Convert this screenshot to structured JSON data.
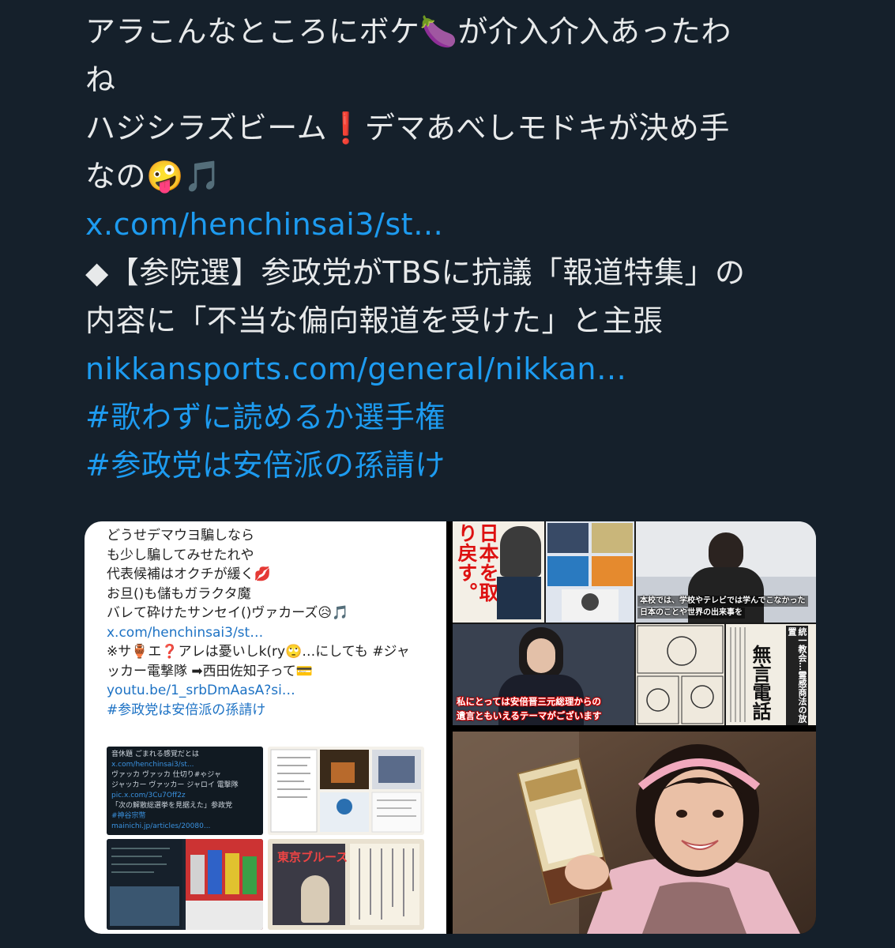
{
  "tweet": {
    "lines": [
      {
        "text": "アラこんなところにボケ🍆が介入介入あったわ",
        "link": false
      },
      {
        "text": "ね",
        "link": false
      },
      {
        "text": "ハジシラズビーム❗デマあべしモドキが決め手",
        "link": false
      },
      {
        "text": "なの🤪🎵",
        "link": false
      },
      {
        "text": "x.com/henchinsai3/st…",
        "link": true
      },
      {
        "text": "◆【参院選】参政党がTBSに抗議「報道特集」の",
        "link": false
      },
      {
        "text": "内容に「不当な偏向報道を受けた」と主張",
        "link": false
      },
      {
        "text": "nikkansports.com/general/nikkan…",
        "link": true
      },
      {
        "text": "#歌わずに読めるか選手権",
        "link": true
      },
      {
        "text": "#参政党は安倍派の孫請け",
        "link": true
      }
    ]
  },
  "media": {
    "left_tile": {
      "lines": [
        {
          "text": "どうせデマウヨ騙しなら",
          "link": false
        },
        {
          "text": "も少し騙してみせたれや",
          "link": false
        },
        {
          "text": "代表候補はオクチが緩く💋",
          "link": false
        },
        {
          "text": "お旦()も儲もガラクタ魔",
          "link": false
        },
        {
          "text": "バレて砕けたサンセイ()ヴァカーズ😥🎵",
          "link": false
        },
        {
          "text": "x.com/henchinsai3/st…",
          "link": true
        },
        {
          "text": "※サ🏺エ❓アレは憂いしk(ry🙄…にしても #ジャ",
          "link": false
        },
        {
          "text": "ッカー電撃隊 ➡西田佐知子って💳",
          "link": false
        },
        {
          "text": "youtu.be/1_srbDmAasA?si…",
          "link": true
        },
        {
          "text": "#参政党は安倍派の孫請け",
          "link": true
        }
      ],
      "mini_tweet": [
        "音休題 ごまれる感覚だとは",
        "x.com/henchinsai3/st...",
        "ヴァッカ ヴァッカ 仕切り#ゃジャ",
        "ジャッカー ヴァッカー ジャロイ 電撃隊",
        "pic.x.com/3Cu7Off2z",
        "「次の解散総選挙を見据えた」参政党",
        "#神谷宗幣",
        "mainichi.jp/articles/20080..."
      ],
      "mini_bottom_title": "東京ブルース"
    },
    "collage": {
      "poster_text": "日本を取り戻す。",
      "studio_caption_1": "本校では、学校やテレビでは学んでこなかった",
      "studio_caption_2": "日本のことや世界の出来事を",
      "speech_caption_1": "私にとっては安倍晋三元総理からの",
      "speech_caption_2": "遺言ともいえるテーマがございます",
      "news_headline": "無言電話",
      "news_sub": "統一教会…霊感商法の放置"
    }
  },
  "colors": {
    "background": "#15202b",
    "text": "#e7e9ea",
    "link": "#1d9bf0"
  }
}
